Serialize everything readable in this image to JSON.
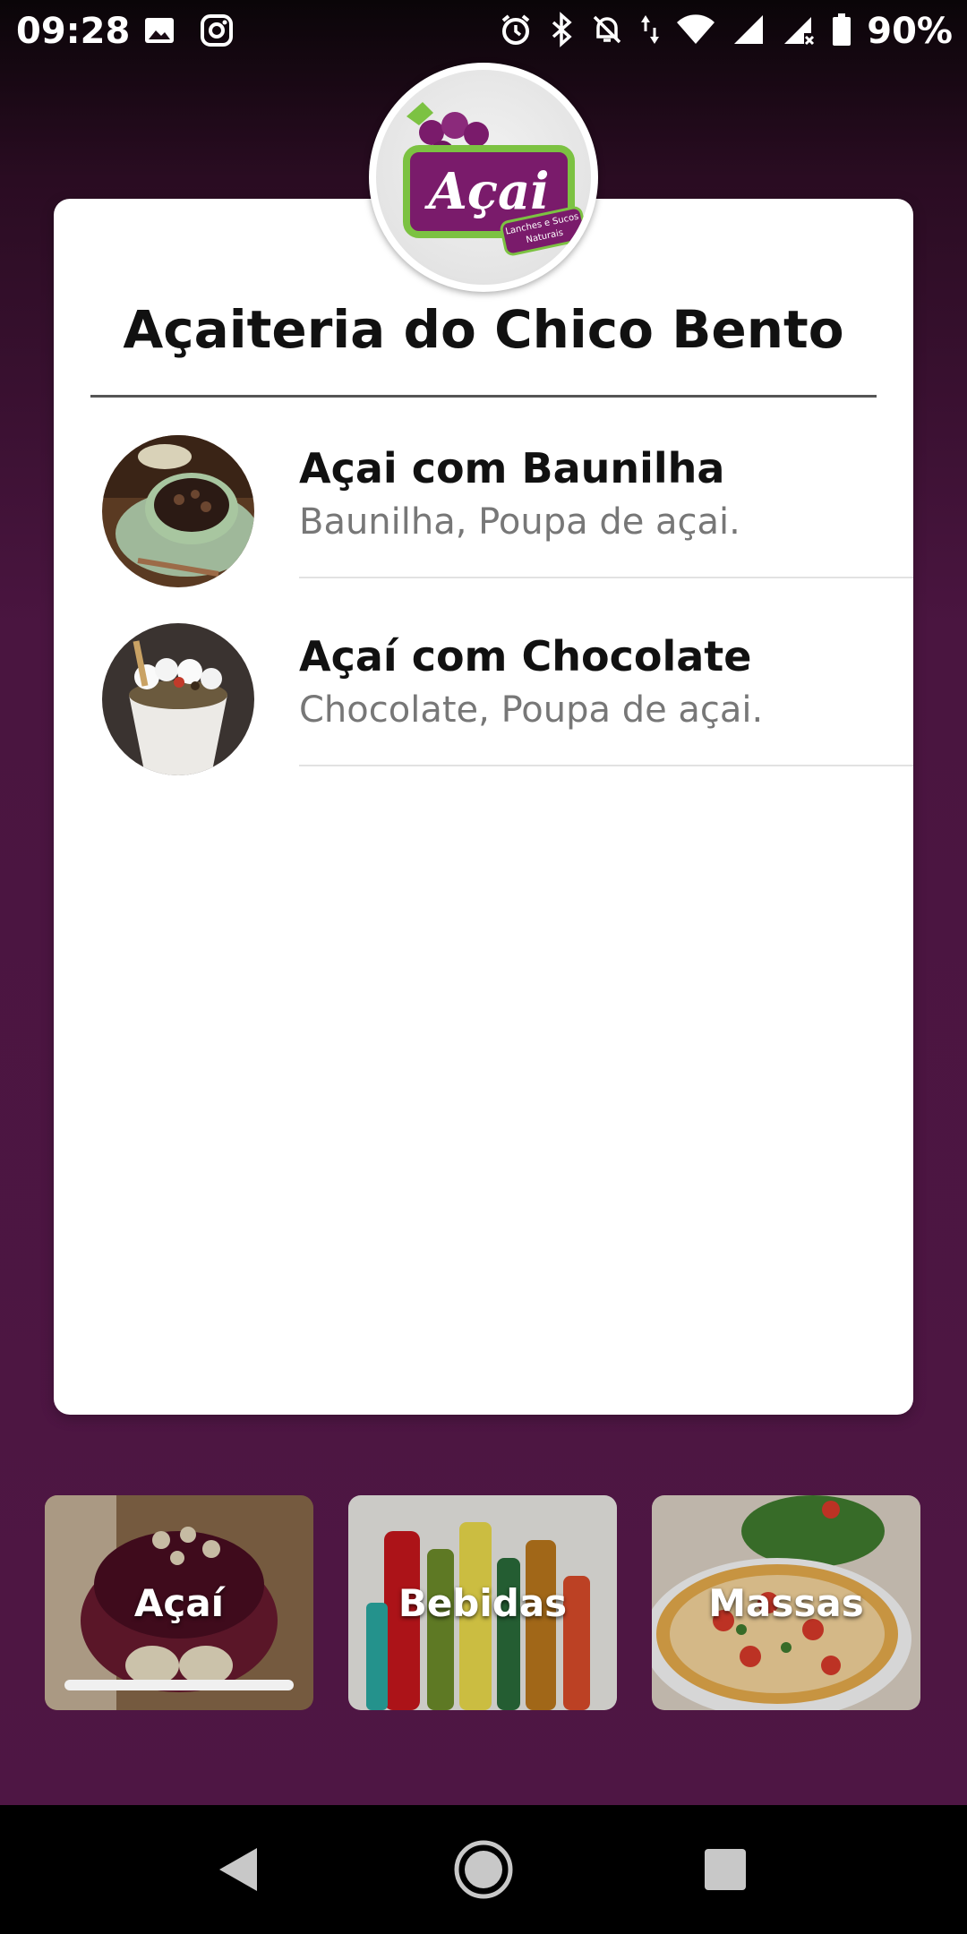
{
  "status_bar": {
    "time": "09:28",
    "battery": "90%",
    "left_icons": [
      "image-icon",
      "instagram-icon"
    ],
    "right_icons": [
      "alarm-icon",
      "bluetooth-icon",
      "notifications-off-icon",
      "data-arrows-icon",
      "wifi-icon",
      "signal-icon",
      "signal-no-data-icon",
      "battery-icon"
    ]
  },
  "logo": {
    "word": "Açai",
    "tagline": "Lanches e Sucos Naturais"
  },
  "restaurant": {
    "name": "Açaiteria do Chico Bento"
  },
  "menu_items": [
    {
      "name": "Açai com Baunilha",
      "description": "Baunilha, Poupa de açai."
    },
    {
      "name": "Açaí com Chocolate",
      "description": "Chocolate, Poupa de açai."
    }
  ],
  "categories": [
    {
      "label": "Açaí",
      "selected": true
    },
    {
      "label": "Bebidas",
      "selected": false
    },
    {
      "label": "Massas",
      "selected": false
    }
  ],
  "colors": {
    "background": "#4f1644",
    "card": "#ffffff",
    "brand_purple": "#7a1b6b",
    "brand_green": "#7cc242"
  },
  "nav": {
    "icons": [
      "back-icon",
      "home-icon",
      "recents-icon"
    ]
  }
}
